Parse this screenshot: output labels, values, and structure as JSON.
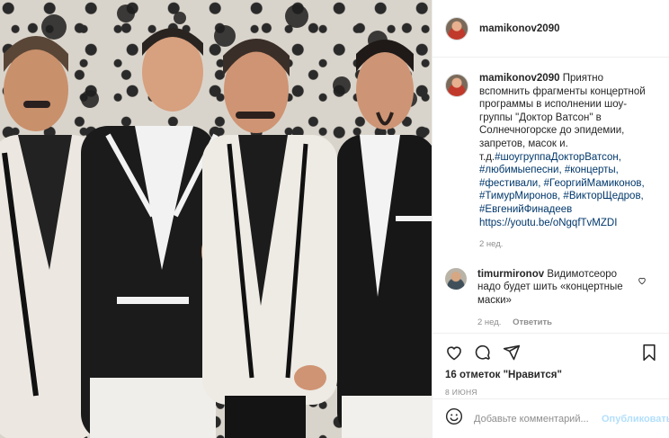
{
  "post": {
    "username": "mamikonov2090",
    "photo_alt": ""
  },
  "caption": {
    "username": "mamikonov2090",
    "text": "Приятно вспомнить фрагменты концертной программы в исполнении шоу-группы \"Доктор Ватсон\" в Солнечногорске до эпидемии, запретов, масок и. т.д.",
    "hashtags": "#шоугруппаДокторВатсон, #любимыепесни, #концерты, #фестивали, #ГеоргийМамиконов, #ТимурМиронов, #ВикторЩедров, #ЕвгенийФинадеев",
    "link": "https://youtu.be/oNgqfTvMZDI",
    "time": "2 нед."
  },
  "comments": [
    {
      "username": "timurmironov",
      "text": "Видимотсеоро надо будет шить «концертные маски»",
      "time": "2 нед.",
      "reply_label": "Ответить"
    }
  ],
  "actions": {
    "likes": "16 отметок \"Нравится\"",
    "date": "8 июня"
  },
  "add_comment": {
    "placeholder": "Добавьте комментарий...",
    "publish_label": "Опубликовать"
  }
}
